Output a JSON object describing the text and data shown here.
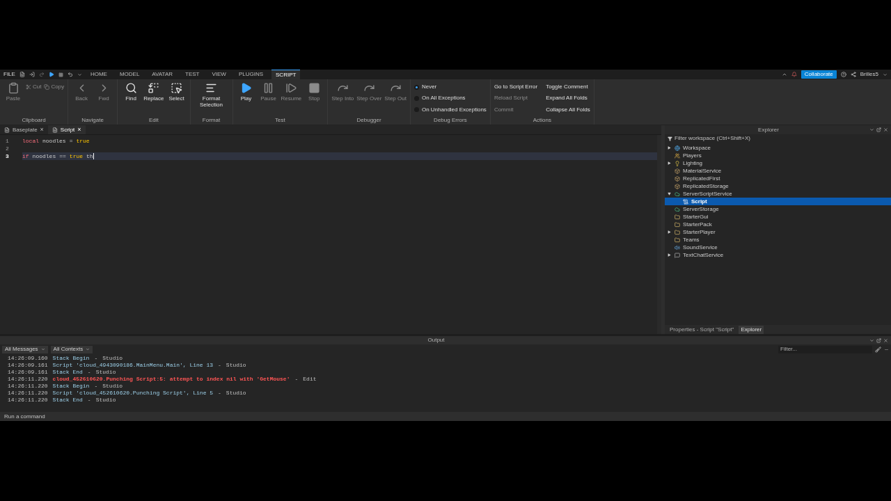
{
  "menu": {
    "file": "FILE",
    "tabs": [
      {
        "label": "HOME",
        "selected": false
      },
      {
        "label": "MODEL",
        "selected": false
      },
      {
        "label": "AVATAR",
        "selected": false
      },
      {
        "label": "TEST",
        "selected": false
      },
      {
        "label": "VIEW",
        "selected": false
      },
      {
        "label": "PLUGINS",
        "selected": false
      },
      {
        "label": "SCRIPT",
        "selected": true
      }
    ],
    "collaborate": "Collaborate",
    "user": "Brilles5"
  },
  "ribbon": [
    {
      "label": "Clipboard",
      "items": [
        {
          "kind": "large",
          "label": "Paste",
          "disabled": true
        },
        {
          "kind": "small",
          "label": "Cut",
          "disabled": true
        },
        {
          "kind": "small",
          "label": "Copy",
          "disabled": true
        }
      ]
    },
    {
      "label": "Navigate",
      "items": [
        {
          "kind": "large",
          "label": "Back",
          "disabled": true
        },
        {
          "kind": "large",
          "label": "Fwd",
          "disabled": true
        }
      ]
    },
    {
      "label": "Edit",
      "items": [
        {
          "kind": "large",
          "label": "Find",
          "disabled": false
        },
        {
          "kind": "large",
          "label": "Replace",
          "disabled": false
        },
        {
          "kind": "large",
          "label": "Select",
          "disabled": false
        }
      ]
    },
    {
      "label": "Format",
      "items": [
        {
          "kind": "large",
          "label": "Format Selection",
          "disabled": false
        }
      ]
    },
    {
      "label": "Test",
      "items": [
        {
          "kind": "large",
          "label": "Play",
          "disabled": false
        },
        {
          "kind": "large",
          "label": "Pause",
          "disabled": true
        },
        {
          "kind": "large",
          "label": "Resume",
          "disabled": true
        },
        {
          "kind": "large",
          "label": "Stop",
          "disabled": true
        }
      ]
    },
    {
      "label": "Debugger",
      "items": [
        {
          "kind": "large",
          "label": "Step Into",
          "disabled": true
        },
        {
          "kind": "large",
          "label": "Step Over",
          "disabled": true
        },
        {
          "kind": "large",
          "label": "Step Out",
          "disabled": true
        }
      ]
    },
    {
      "label": "Debug Errors",
      "items": [
        {
          "kind": "radio",
          "label": "Never",
          "selected": true
        },
        {
          "kind": "radio",
          "label": "On All Exceptions",
          "selected": false
        },
        {
          "kind": "radio",
          "label": "On Unhandled Exceptions",
          "selected": false
        }
      ]
    },
    {
      "label": "Actions",
      "items": [
        {
          "kind": "text",
          "label": "Go to Script Error",
          "disabled": false
        },
        {
          "kind": "text",
          "label": "Reload Script",
          "disabled": true
        },
        {
          "kind": "text",
          "label": "Commit",
          "disabled": true
        },
        {
          "kind": "text",
          "label": "Toggle Comment",
          "disabled": false
        },
        {
          "kind": "text",
          "label": "Expand All Folds",
          "disabled": false
        },
        {
          "kind": "text",
          "label": "Collapse All Folds",
          "disabled": false
        }
      ]
    }
  ],
  "doc_tabs": [
    {
      "label": "Baseplate",
      "close": "×",
      "selected": false
    },
    {
      "label": "Script",
      "close": "×",
      "selected": true
    }
  ],
  "code": [
    {
      "number": "1",
      "current": false,
      "tokens": [
        {
          "kind": "keyword",
          "text": "local"
        },
        {
          "kind": "ident",
          "text": "noodles"
        },
        {
          "kind": "op",
          "text": "="
        },
        {
          "kind": "bool",
          "text": "true"
        }
      ]
    },
    {
      "number": "2",
      "current": false
    },
    {
      "number": "3",
      "current": true,
      "tokens": [
        {
          "kind": "keyword",
          "text": "if"
        },
        {
          "kind": "ident",
          "text": "noodles"
        },
        {
          "kind": "op",
          "text": "=="
        },
        {
          "kind": "bool",
          "text": "true"
        },
        {
          "kind": "ident",
          "text": "th"
        }
      ]
    }
  ],
  "explorer": {
    "title": "Explorer",
    "filter": "Filter workspace (Ctrl+Shift+X)",
    "items": [
      {
        "name": "Workspace",
        "expanded": false,
        "selected": false
      },
      {
        "name": "Players",
        "selected": false
      },
      {
        "name": "Lighting",
        "expanded": false,
        "selected": false
      },
      {
        "name": "MaterialService",
        "selected": false
      },
      {
        "name": "ReplicatedFirst",
        "selected": false
      },
      {
        "name": "ReplicatedStorage",
        "selected": false
      },
      {
        "name": "ServerScriptService",
        "expanded": true,
        "selected": false,
        "children": [
          {
            "name": "Script",
            "selected": true
          }
        ]
      },
      {
        "name": "ServerStorage",
        "selected": false
      },
      {
        "name": "StarterGui",
        "selected": false
      },
      {
        "name": "StarterPack",
        "selected": false
      },
      {
        "name": "StarterPlayer",
        "expanded": false,
        "selected": false
      },
      {
        "name": "Teams",
        "selected": false
      },
      {
        "name": "SoundService",
        "selected": false
      },
      {
        "name": "TextChatService",
        "expanded": false,
        "selected": false
      }
    ],
    "bottom_tabs": [
      {
        "label": "Properties - Script \"Script\"",
        "selected": false
      },
      {
        "label": "Explorer",
        "selected": true
      }
    ]
  },
  "output": {
    "title": "Output",
    "filters": [
      "All Messages",
      "All Contexts"
    ],
    "search_placeholder": "Filter...",
    "lines": [
      {
        "time": "14:26:09.160",
        "message": "Stack Begin",
        "separator": "-",
        "source": "Studio",
        "kind": "info"
      },
      {
        "time": "14:26:09.161",
        "message": "Script 'cloud_4943090186.MainMenu.Main', Line 13",
        "separator": "-",
        "source": "Studio",
        "kind": "info"
      },
      {
        "time": "14:26:09.161",
        "message": "Stack End",
        "separator": "-",
        "source": "Studio",
        "kind": "info"
      },
      {
        "time": "14:26:11.220",
        "message": "cloud_452610620.Punching Script:5: attempt to index nil with 'GetMouse'",
        "separator": "-",
        "source": "Edit",
        "kind": "error"
      },
      {
        "time": "14:26:11.220",
        "message": "Stack Begin",
        "separator": "-",
        "source": "Studio",
        "kind": "info"
      },
      {
        "time": "14:26:11.220",
        "message": "Script 'cloud_452610620.Punching Script', Line 5",
        "separator": "-",
        "source": "Studio",
        "kind": "info"
      },
      {
        "time": "14:26:11.220",
        "message": "Stack End",
        "separator": "-",
        "source": "Studio",
        "kind": "info"
      }
    ]
  },
  "command_bar": {
    "placeholder": "Run a command"
  }
}
